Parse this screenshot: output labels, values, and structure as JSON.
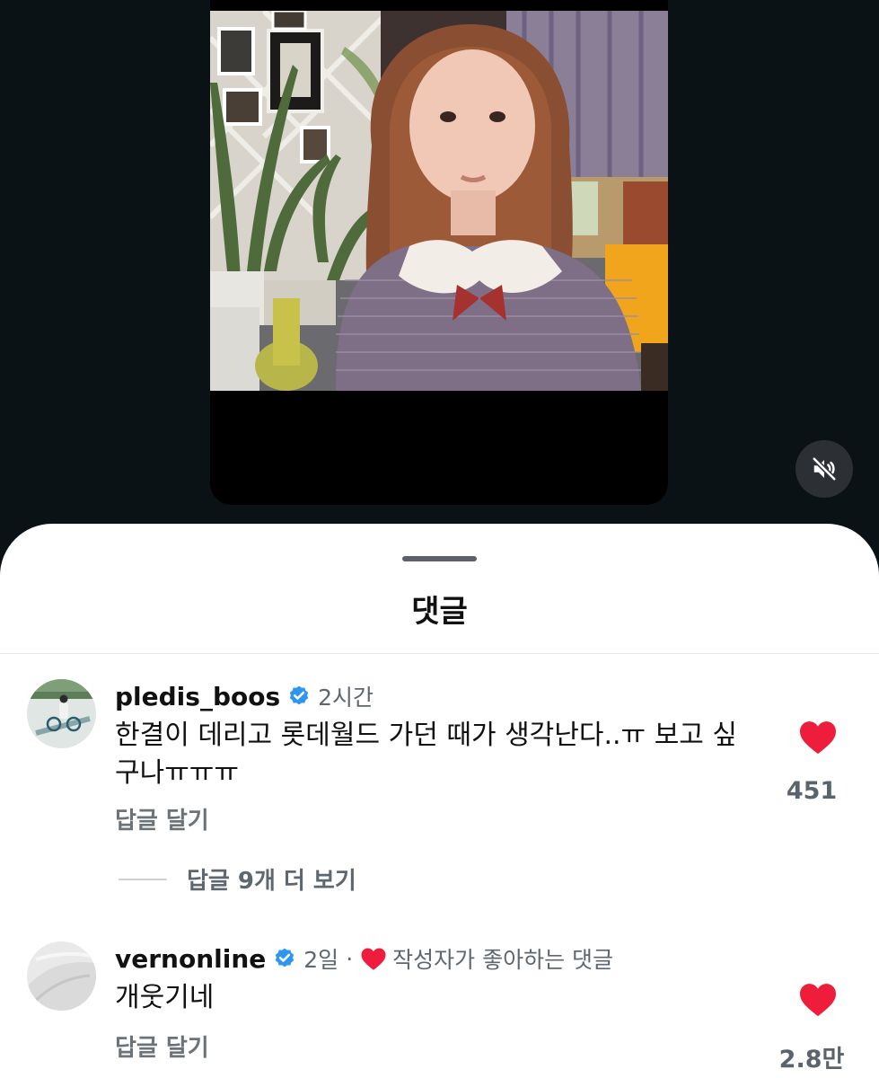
{
  "sheet": {
    "title": "댓글"
  },
  "comments": [
    {
      "username": "pledis_boos",
      "verified": true,
      "time": "2시간",
      "text": "한결이 데리고 롯데월드 가던 때가 생각난다..ㅠ 보고 싶구나ㅠㅠㅠ",
      "reply_label": "답글 달기",
      "likes": "451",
      "view_more_replies": "답글 9개 더 보기"
    },
    {
      "username": "vernonline",
      "verified": true,
      "time": "2일",
      "separator": "·",
      "author_liked_label": "작성자가 좋아하는 댓글",
      "text": "개웃기네",
      "reply_label": "답글 달기",
      "likes": "2.8만"
    }
  ],
  "colors": {
    "heart": "#ee1d3c",
    "verified": "#2f96f0",
    "background": "#0b1216"
  },
  "icons": {
    "mute": "speaker-muted-icon",
    "like": "heart-icon",
    "verified": "verified-badge-icon"
  }
}
